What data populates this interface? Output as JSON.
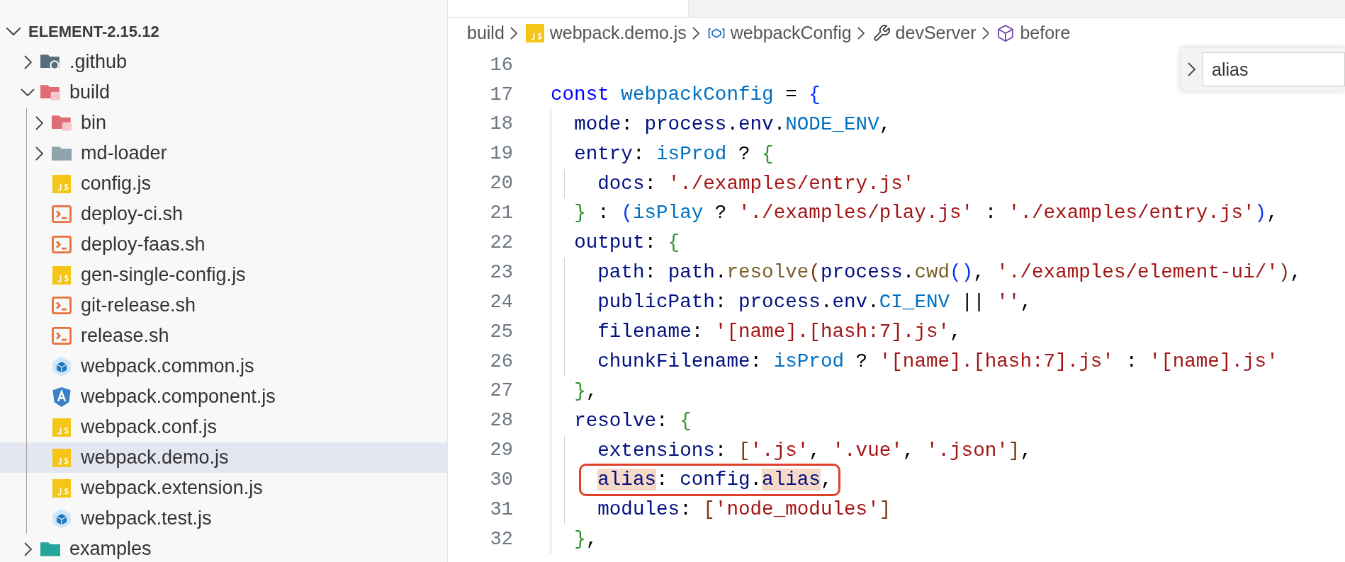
{
  "explorer": {
    "root": {
      "label": "ELEMENT-2.15.12",
      "expanded": true,
      "children": [
        {
          "label": ".github",
          "kind": "folder-github",
          "expanded": false,
          "selected": false
        },
        {
          "label": "build",
          "kind": "folder-red-open",
          "expanded": true,
          "selected": false,
          "children": [
            {
              "label": "bin",
              "kind": "folder-red",
              "expanded": false,
              "selected": false
            },
            {
              "label": "md-loader",
              "kind": "folder",
              "expanded": false,
              "selected": false
            },
            {
              "label": "config.js",
              "kind": "js",
              "selected": false
            },
            {
              "label": "deploy-ci.sh",
              "kind": "shell",
              "selected": false
            },
            {
              "label": "deploy-faas.sh",
              "kind": "shell",
              "selected": false
            },
            {
              "label": "gen-single-config.js",
              "kind": "js",
              "selected": false
            },
            {
              "label": "git-release.sh",
              "kind": "shell",
              "selected": false
            },
            {
              "label": "release.sh",
              "kind": "shell",
              "selected": false
            },
            {
              "label": "webpack.common.js",
              "kind": "webpack",
              "selected": false
            },
            {
              "label": "webpack.component.js",
              "kind": "angular",
              "selected": false
            },
            {
              "label": "webpack.conf.js",
              "kind": "js",
              "selected": false
            },
            {
              "label": "webpack.demo.js",
              "kind": "js",
              "selected": true
            },
            {
              "label": "webpack.extension.js",
              "kind": "js",
              "selected": false
            },
            {
              "label": "webpack.test.js",
              "kind": "webpack",
              "selected": false
            }
          ]
        },
        {
          "label": "examples",
          "kind": "folder-teal",
          "expanded": false,
          "selected": false
        }
      ]
    }
  },
  "breadcrumbs": [
    {
      "label": "build",
      "kind": "folder"
    },
    {
      "label": "webpack.demo.js",
      "kind": "js"
    },
    {
      "label": "webpackConfig",
      "kind": "variable"
    },
    {
      "label": "devServer",
      "kind": "wrench"
    },
    {
      "label": "before",
      "kind": "cube"
    }
  ],
  "find_widget": {
    "value": "alias",
    "expanded": false
  },
  "code": [
    {
      "number": "16",
      "annotated": false
    },
    {
      "number": "17",
      "annotated": false,
      "tokens": [
        {
          "t": "const ",
          "kind": "kw"
        },
        {
          "t": "webpackConfig",
          "kind": "var"
        },
        {
          "t": " = ",
          "kind": "p"
        },
        {
          "t": "{",
          "kind": "b1"
        }
      ]
    },
    {
      "number": "18",
      "annotated": false,
      "tokens": [
        {
          "t": "  mode",
          "kind": "prop"
        },
        {
          "t": ": ",
          "kind": "p"
        },
        {
          "t": "process",
          "kind": "prop"
        },
        {
          "t": ".",
          "kind": "p"
        },
        {
          "t": "env",
          "kind": "prop"
        },
        {
          "t": ".",
          "kind": "p"
        },
        {
          "t": "NODE_ENV",
          "kind": "var"
        },
        {
          "t": ",",
          "kind": "p"
        }
      ]
    },
    {
      "number": "19",
      "annotated": false,
      "tokens": [
        {
          "t": "  entry",
          "kind": "prop"
        },
        {
          "t": ": ",
          "kind": "p"
        },
        {
          "t": "isProd",
          "kind": "var"
        },
        {
          "t": " ? ",
          "kind": "p"
        },
        {
          "t": "{",
          "kind": "b2"
        }
      ]
    },
    {
      "number": "20",
      "annotated": false,
      "tokens": [
        {
          "t": "    docs",
          "kind": "prop"
        },
        {
          "t": ": ",
          "kind": "p"
        },
        {
          "t": "'./examples/entry.js'",
          "kind": "str"
        }
      ]
    },
    {
      "number": "21",
      "annotated": false,
      "tokens": [
        {
          "t": "  }",
          "kind": "b2"
        },
        {
          "t": " : ",
          "kind": "p"
        },
        {
          "t": "(",
          "kind": "b1"
        },
        {
          "t": "isPlay",
          "kind": "var"
        },
        {
          "t": " ? ",
          "kind": "p"
        },
        {
          "t": "'./examples/play.js'",
          "kind": "str"
        },
        {
          "t": " : ",
          "kind": "p"
        },
        {
          "t": "'./examples/entry.js'",
          "kind": "str"
        },
        {
          "t": ")",
          "kind": "b1"
        },
        {
          "t": ",",
          "kind": "p"
        }
      ]
    },
    {
      "number": "22",
      "annotated": false,
      "tokens": [
        {
          "t": "  output",
          "kind": "prop"
        },
        {
          "t": ": ",
          "kind": "p"
        },
        {
          "t": "{",
          "kind": "b2"
        }
      ]
    },
    {
      "number": "23",
      "annotated": false,
      "tokens": [
        {
          "t": "    path",
          "kind": "prop"
        },
        {
          "t": ": ",
          "kind": "p"
        },
        {
          "t": "path",
          "kind": "prop"
        },
        {
          "t": ".",
          "kind": "p"
        },
        {
          "t": "resolve",
          "kind": "fn"
        },
        {
          "t": "(",
          "kind": "b3"
        },
        {
          "t": "process",
          "kind": "prop"
        },
        {
          "t": ".",
          "kind": "p"
        },
        {
          "t": "cwd",
          "kind": "fn"
        },
        {
          "t": "()",
          "kind": "b1"
        },
        {
          "t": ", ",
          "kind": "p"
        },
        {
          "t": "'./examples/element-ui/'",
          "kind": "str"
        },
        {
          "t": ")",
          "kind": "b3"
        },
        {
          "t": ",",
          "kind": "p"
        }
      ]
    },
    {
      "number": "24",
      "annotated": false,
      "tokens": [
        {
          "t": "    publicPath",
          "kind": "prop"
        },
        {
          "t": ": ",
          "kind": "p"
        },
        {
          "t": "process",
          "kind": "prop"
        },
        {
          "t": ".",
          "kind": "p"
        },
        {
          "t": "env",
          "kind": "prop"
        },
        {
          "t": ".",
          "kind": "p"
        },
        {
          "t": "CI_ENV",
          "kind": "var"
        },
        {
          "t": " || ",
          "kind": "p"
        },
        {
          "t": "''",
          "kind": "str"
        },
        {
          "t": ",",
          "kind": "p"
        }
      ]
    },
    {
      "number": "25",
      "annotated": false,
      "tokens": [
        {
          "t": "    filename",
          "kind": "prop"
        },
        {
          "t": ": ",
          "kind": "p"
        },
        {
          "t": "'[name].[hash:7].js'",
          "kind": "str"
        },
        {
          "t": ",",
          "kind": "p"
        }
      ]
    },
    {
      "number": "26",
      "annotated": false,
      "tokens": [
        {
          "t": "    chunkFilename",
          "kind": "prop"
        },
        {
          "t": ": ",
          "kind": "p"
        },
        {
          "t": "isProd",
          "kind": "var"
        },
        {
          "t": " ? ",
          "kind": "p"
        },
        {
          "t": "'[name].[hash:7].js'",
          "kind": "str"
        },
        {
          "t": " : ",
          "kind": "p"
        },
        {
          "t": "'[name].js'",
          "kind": "str"
        }
      ]
    },
    {
      "number": "27",
      "annotated": false,
      "tokens": [
        {
          "t": "  }",
          "kind": "b2"
        },
        {
          "t": ",",
          "kind": "p"
        }
      ]
    },
    {
      "number": "28",
      "annotated": false,
      "tokens": [
        {
          "t": "  resolve",
          "kind": "prop"
        },
        {
          "t": ": ",
          "kind": "p"
        },
        {
          "t": "{",
          "kind": "b2"
        }
      ]
    },
    {
      "number": "29",
      "annotated": false,
      "tokens": [
        {
          "t": "    extensions",
          "kind": "prop"
        },
        {
          "t": ": ",
          "kind": "p"
        },
        {
          "t": "[",
          "kind": "b3"
        },
        {
          "t": "'.js'",
          "kind": "str"
        },
        {
          "t": ", ",
          "kind": "p"
        },
        {
          "t": "'.vue'",
          "kind": "str"
        },
        {
          "t": ", ",
          "kind": "p"
        },
        {
          "t": "'.json'",
          "kind": "str"
        },
        {
          "t": "]",
          "kind": "b3"
        },
        {
          "t": ",",
          "kind": "p"
        }
      ]
    },
    {
      "number": "30",
      "annotated": true,
      "tokens": [
        {
          "t": "    alias",
          "kind": "match"
        },
        {
          "t": ": ",
          "kind": "p"
        },
        {
          "t": "config",
          "kind": "prop"
        },
        {
          "t": ".",
          "kind": "p"
        },
        {
          "t": "alias",
          "kind": "match"
        },
        {
          "t": ",",
          "kind": "p"
        }
      ]
    },
    {
      "number": "31",
      "annotated": false,
      "tokens": [
        {
          "t": "    modules",
          "kind": "prop"
        },
        {
          "t": ": ",
          "kind": "p"
        },
        {
          "t": "[",
          "kind": "b3"
        },
        {
          "t": "'node_modules'",
          "kind": "str"
        },
        {
          "t": "]",
          "kind": "b3"
        }
      ]
    },
    {
      "number": "32",
      "annotated": false,
      "tokens": [
        {
          "t": "  }",
          "kind": "b2"
        },
        {
          "t": ",",
          "kind": "p"
        }
      ]
    }
  ]
}
